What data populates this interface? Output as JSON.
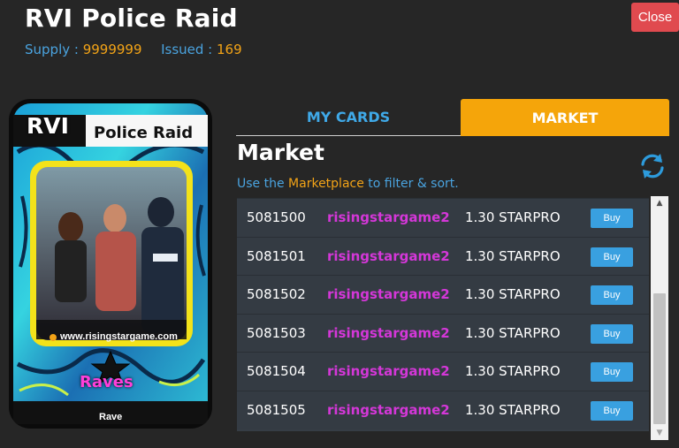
{
  "header": {
    "title": "RVI Police Raid",
    "supply_label": "Supply :",
    "supply_value": "9999999",
    "issued_label": "Issued :",
    "issued_value": "169",
    "close_label": "Close"
  },
  "card": {
    "name_line1": "RVI",
    "name_line2": "Police Raid",
    "url": "www.risingstargame.com",
    "set": "Raves",
    "type": "Rave"
  },
  "tabs": [
    {
      "label": "MY CARDS",
      "active": false
    },
    {
      "label": "MARKET",
      "active": true
    }
  ],
  "market": {
    "heading": "Market",
    "hint_prefix": "Use the",
    "hint_link": "Marketplace",
    "hint_suffix": "to filter & sort.",
    "refresh_icon": "refresh-icon",
    "rows": [
      {
        "id": "5081500",
        "seller": "risingstargame2",
        "price": "1.30 STARPRO",
        "action": "Buy"
      },
      {
        "id": "5081501",
        "seller": "risingstargame2",
        "price": "1.30 STARPRO",
        "action": "Buy"
      },
      {
        "id": "5081502",
        "seller": "risingstargame2",
        "price": "1.30 STARPRO",
        "action": "Buy"
      },
      {
        "id": "5081503",
        "seller": "risingstargame2",
        "price": "1.30 STARPRO",
        "action": "Buy"
      },
      {
        "id": "5081504",
        "seller": "risingstargame2",
        "price": "1.30 STARPRO",
        "action": "Buy"
      },
      {
        "id": "5081505",
        "seller": "risingstargame2",
        "price": "1.30 STARPRO",
        "action": "Buy"
      }
    ]
  },
  "colors": {
    "background": "#262626",
    "accent_blue": "#4aa3df",
    "accent_orange": "#f5a50a",
    "close_red": "#e04a4f",
    "seller_magenta": "#d437d8",
    "buy_blue": "#39a0e0"
  }
}
